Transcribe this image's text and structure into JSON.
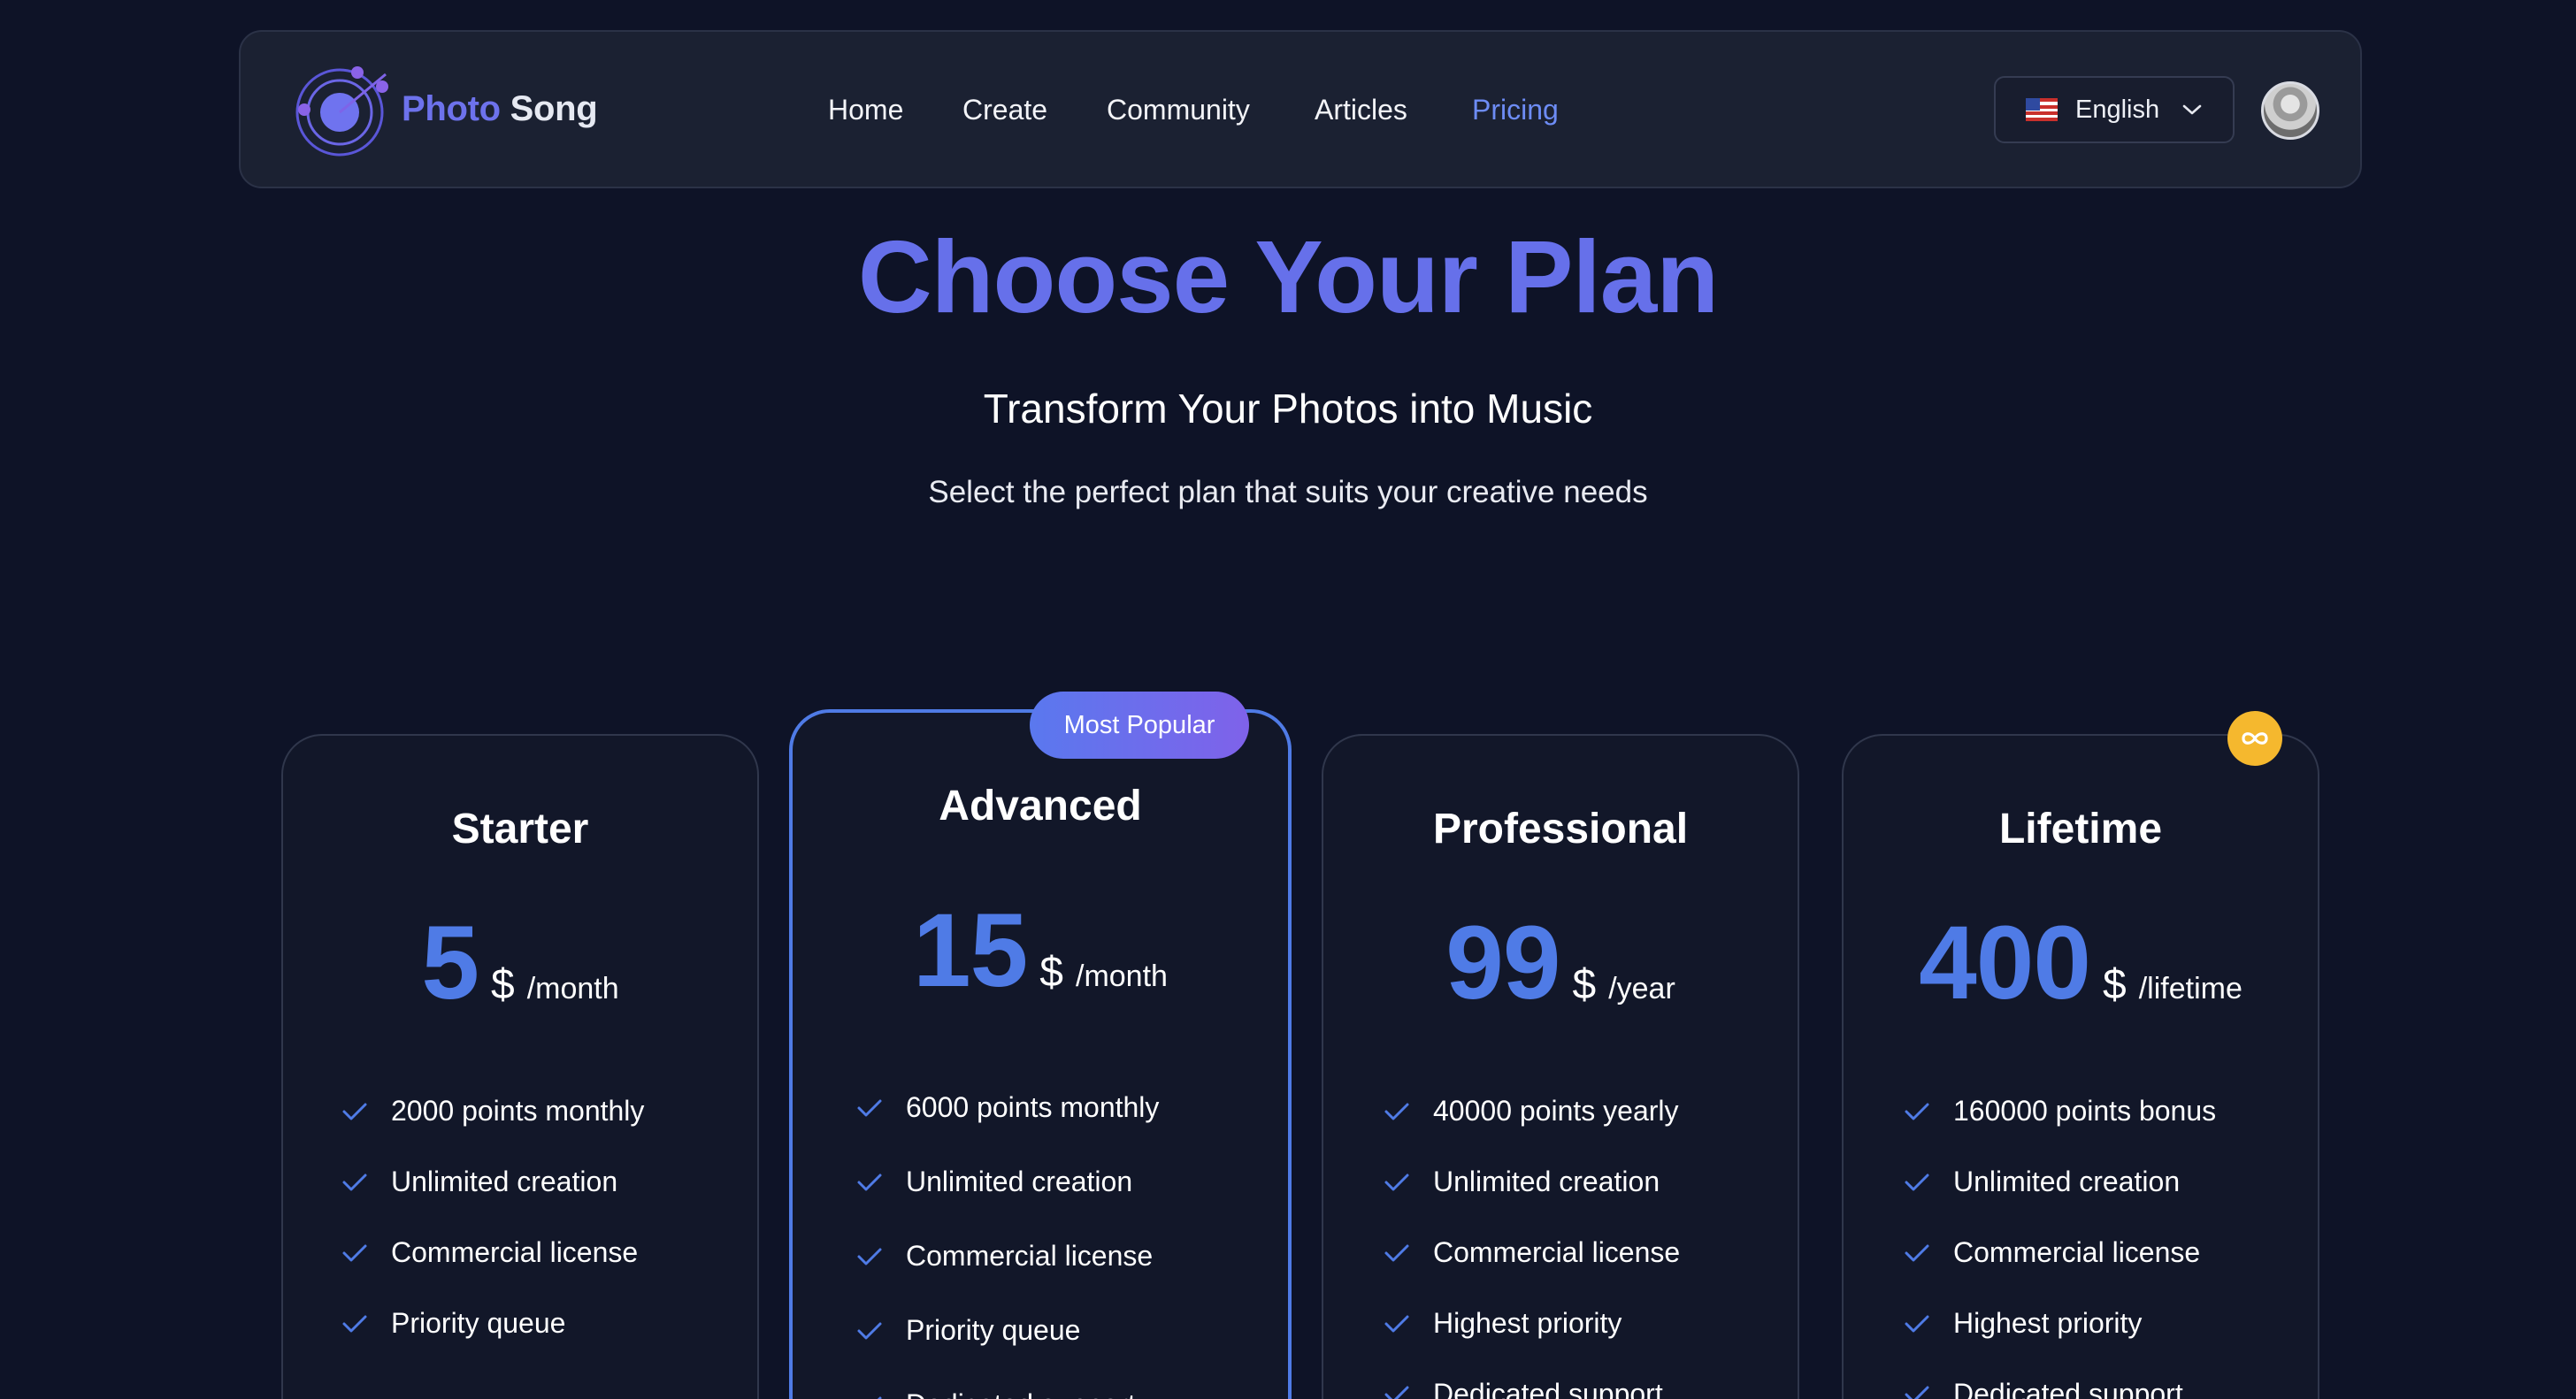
{
  "nav": {
    "brand": {
      "word1": "Photo",
      "word2": "Song"
    },
    "links": [
      {
        "label": "Home",
        "active": false
      },
      {
        "label": "Create",
        "active": false
      },
      {
        "label": "Community",
        "active": false
      },
      {
        "label": "Articles",
        "active": false
      },
      {
        "label": "Pricing",
        "active": true
      }
    ],
    "language": {
      "flag_icon": "us-flag-icon",
      "label": "English"
    }
  },
  "hero": {
    "title": "Choose Your Plan",
    "subtitle": "Transform Your Photos into Music",
    "description": "Select the perfect plan that suits your creative needs"
  },
  "plans": [
    {
      "name": "Starter",
      "price": "5",
      "currency": "$",
      "period": "/month",
      "features": [
        "2000 points monthly",
        "Unlimited creation",
        "Commercial license",
        "Priority queue"
      ]
    },
    {
      "name": "Advanced",
      "price": "15",
      "currency": "$",
      "period": "/month",
      "badge": "Most Popular",
      "features": [
        "6000 points monthly",
        "Unlimited creation",
        "Commercial license",
        "Priority queue",
        "Dedicated support"
      ]
    },
    {
      "name": "Professional",
      "price": "99",
      "currency": "$",
      "period": "/year",
      "features": [
        "40000 points yearly",
        "Unlimited creation",
        "Commercial license",
        "Highest priority",
        "Dedicated support"
      ]
    },
    {
      "name": "Lifetime",
      "price": "400",
      "currency": "$",
      "period": "/lifetime",
      "badge_icon": "infinity-icon",
      "features": [
        "160000 points bonus",
        "Unlimited creation",
        "Commercial license",
        "Highest priority",
        "Dedicated support"
      ]
    }
  ],
  "colors": {
    "background": "#0e1327",
    "accent": "#4f7be6",
    "title": "#6670ea",
    "active_link": "#6d8cf5",
    "badge_lifetime": "#f5b82e"
  }
}
